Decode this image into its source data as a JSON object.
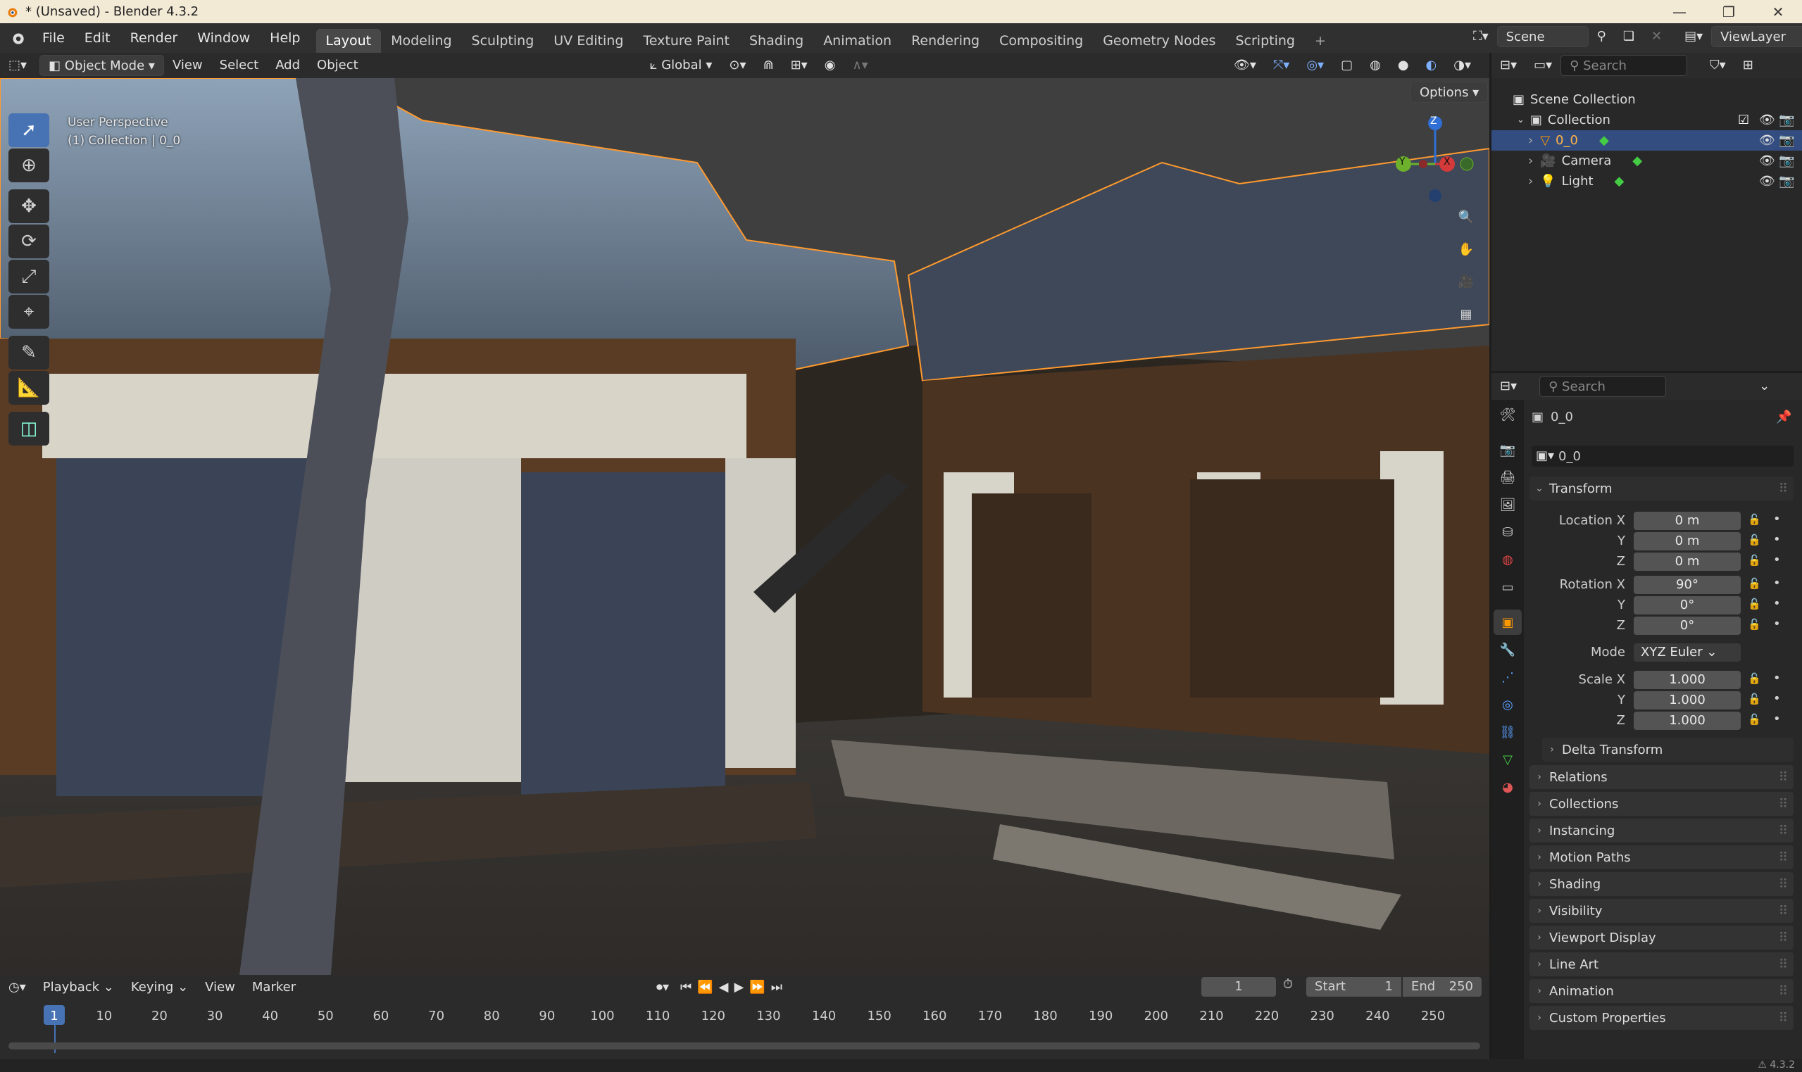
{
  "window": {
    "title": "* (Unsaved) - Blender 4.3.2"
  },
  "menus": [
    "File",
    "Edit",
    "Render",
    "Window",
    "Help"
  ],
  "workspaces": [
    "Layout",
    "Modeling",
    "Sculpting",
    "UV Editing",
    "Texture Paint",
    "Shading",
    "Animation",
    "Rendering",
    "Compositing",
    "Geometry Nodes",
    "Scripting"
  ],
  "active_workspace": "Layout",
  "scene": {
    "label": "Scene"
  },
  "view_layer": {
    "label": "ViewLayer"
  },
  "viewport_header": {
    "mode": "Object Mode",
    "view": "View",
    "select": "Select",
    "add": "Add",
    "object": "Object",
    "orientation": "Global",
    "options": "Options"
  },
  "viewport": {
    "perspective": "User Perspective",
    "collection_line": "(1) Collection | 0_0"
  },
  "gizmo": {
    "x": "X",
    "y": "Y",
    "z": "Z"
  },
  "outliner": {
    "search_placeholder": "Search",
    "scene_collection": "Scene Collection",
    "collection": "Collection",
    "items": [
      {
        "name": "0_0",
        "selected": true
      },
      {
        "name": "Camera",
        "selected": false
      },
      {
        "name": "Light",
        "selected": false
      }
    ]
  },
  "properties": {
    "search_placeholder": "Search",
    "object_name": "0_0",
    "data_name": "0_0",
    "transform_label": "Transform",
    "location_label": "Location X",
    "rotation_label": "Rotation X",
    "scale_label": "Scale X",
    "y_label": "Y",
    "z_label": "Z",
    "mode_label": "Mode",
    "location": [
      "0 m",
      "0 m",
      "0 m"
    ],
    "rotation": [
      "90°",
      "0°",
      "0°"
    ],
    "rotation_mode": "XYZ Euler",
    "scale": [
      "1.000",
      "1.000",
      "1.000"
    ],
    "delta_transform": "Delta Transform",
    "sections": [
      "Relations",
      "Collections",
      "Instancing",
      "Motion Paths",
      "Shading",
      "Visibility",
      "Viewport Display",
      "Line Art",
      "Animation",
      "Custom Properties"
    ]
  },
  "timeline": {
    "menus": [
      "Playback",
      "Keying",
      "View",
      "Marker"
    ],
    "current_frame": "1",
    "start_label": "Start",
    "start": "1",
    "end_label": "End",
    "end": "250",
    "ticks": [
      "1",
      "10",
      "20",
      "30",
      "40",
      "50",
      "60",
      "70",
      "80",
      "90",
      "100",
      "110",
      "120",
      "130",
      "140",
      "150",
      "160",
      "170",
      "180",
      "190",
      "200",
      "210",
      "220",
      "230",
      "240",
      "250"
    ]
  },
  "status": {
    "version": "4.3.2"
  }
}
